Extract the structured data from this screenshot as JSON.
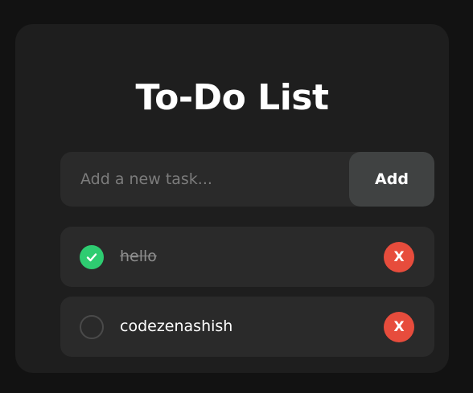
{
  "app": {
    "title": "To-Do List"
  },
  "new_task": {
    "placeholder": "Add a new task...",
    "value": "",
    "add_label": "Add"
  },
  "tasks": [
    {
      "text": "hello",
      "completed": true,
      "delete_label": "X",
      "check_icon": "checkmark-icon"
    },
    {
      "text": "codezenashish",
      "completed": false,
      "delete_label": "X",
      "check_icon": "empty-circle-icon"
    }
  ],
  "colors": {
    "page_background": "#121212",
    "card_background": "#1e1e1e",
    "item_background": "#2a2a2a",
    "add_button": "#404242",
    "completed_check": "#2ecc71",
    "delete_button": "#e74c3c",
    "completed_text": "#8e8e8e"
  }
}
